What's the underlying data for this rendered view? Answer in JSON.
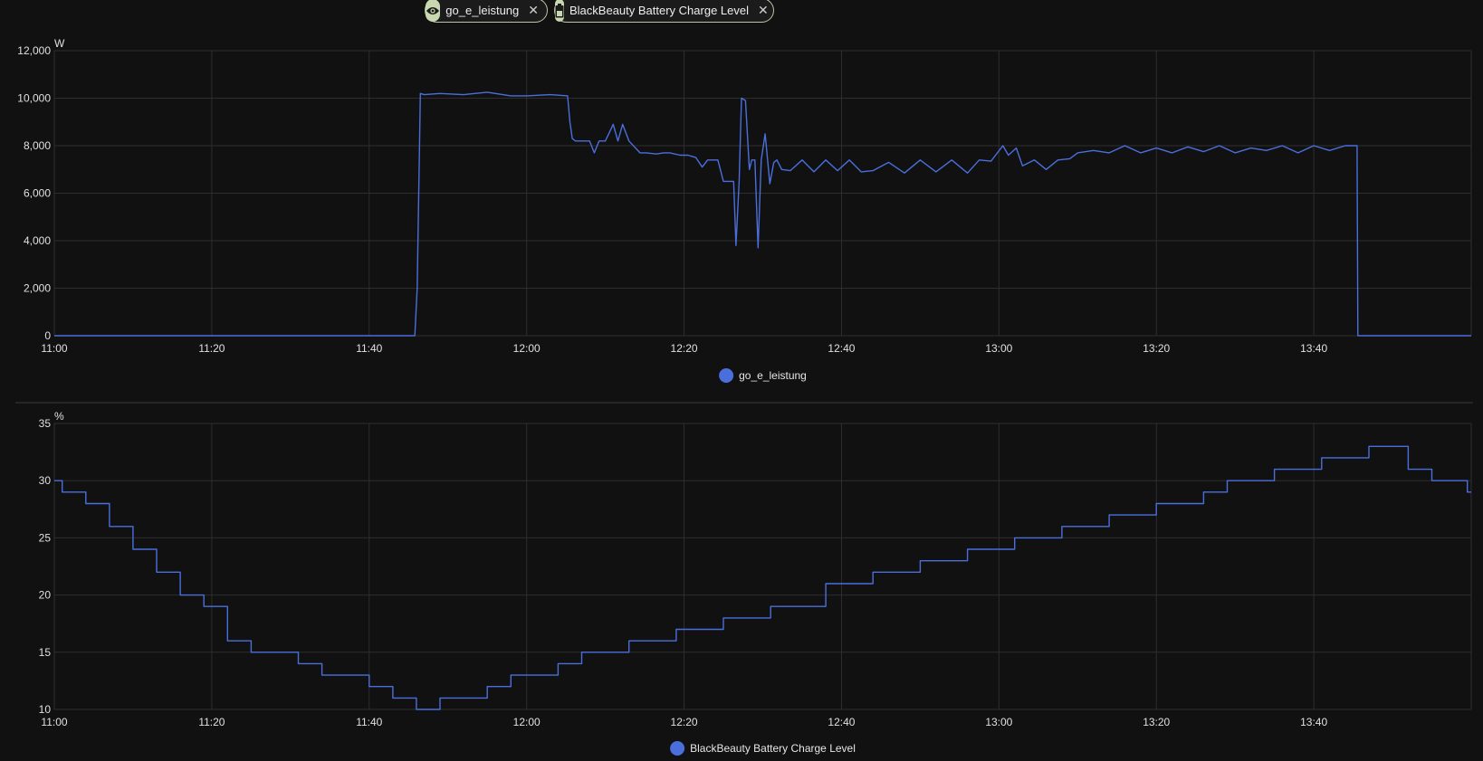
{
  "chips": [
    {
      "label": "go_e_leistung",
      "icon": "eye-icon"
    },
    {
      "label": "BlackBeauty Battery Charge Level",
      "icon": "battery-icon"
    }
  ],
  "colors": {
    "line": "#4a6fdc",
    "grid": "#2e2e2e",
    "background": "#111111",
    "chip_border": "#b9c7a3",
    "chip_icon_bg": "#c9d8b0"
  },
  "chart_data": [
    {
      "type": "line",
      "unit": "W",
      "xlim": [
        "11:00",
        "14:00"
      ],
      "ylim": [
        0,
        12000
      ],
      "x_ticks": [
        "11:00",
        "11:20",
        "11:40",
        "12:00",
        "12:20",
        "12:40",
        "13:00",
        "13:20",
        "13:40"
      ],
      "y_ticks": [
        "0",
        "2,000",
        "4,000",
        "6,000",
        "8,000",
        "10,000",
        "12,000"
      ],
      "y_tick_values": [
        0,
        2000,
        4000,
        6000,
        8000,
        10000,
        12000
      ],
      "grid": true,
      "legend": "bottom-center",
      "series": [
        {
          "name": "go_e_leistung",
          "x": [
            "11:00",
            "11:45.8",
            "11:46.0",
            "11:46.1",
            "11:46.5",
            "11:47.0",
            "11:49.0",
            "11:52.0",
            "11:55.0",
            "11:58.0",
            "12:00.0",
            "12:03.0",
            "12:05.2",
            "12:05.5",
            "12:05.8",
            "12:06.2",
            "12:08.0",
            "12:08.6",
            "12:09.2",
            "12:10.0",
            "12:11.0",
            "12:11.6",
            "12:12.2",
            "12:13.0",
            "12:14.4",
            "12:15.2",
            "12:16.5",
            "12:17.4",
            "12:18.2",
            "12:19.5",
            "12:20.5",
            "12:21.5",
            "12:22.3",
            "12:23.0",
            "12:24.3",
            "12:25.0",
            "12:26.3",
            "12:26.6",
            "12:27.0",
            "12:27.3",
            "12:27.8",
            "12:28.3",
            "12:28.6",
            "12:29.0",
            "12:29.4",
            "12:29.8",
            "12:30.3",
            "12:30.9",
            "12:31.4",
            "12:31.8",
            "12:32.4",
            "12:33.5",
            "12:35.0",
            "12:36.5",
            "12:38.0",
            "12:39.5",
            "12:41.0",
            "12:42.5",
            "12:44.0",
            "12:46.0",
            "12:48.0",
            "12:50.0",
            "12:52.0",
            "12:54.0",
            "12:56.0",
            "12:57.5",
            "12:59.0",
            "13:00.5",
            "13:01.2",
            "13:02.2",
            "13:03.0",
            "13:04.5",
            "13:06.0",
            "13:07.5",
            "13:09.0",
            "13:10.0",
            "13:12.0",
            "13:14.0",
            "13:16.0",
            "13:18.0",
            "13:20.0",
            "13:22.0",
            "13:24.0",
            "13:26.0",
            "13:28.0",
            "13:30.0",
            "13:32.0",
            "13:34.0",
            "13:36.0",
            "13:38.0",
            "13:40.0",
            "13:42.0",
            "13:44.0",
            "13:45.5",
            "13:45.6",
            "13:46.0",
            "14:00"
          ],
          "y": [
            0,
            0,
            1300,
            2000,
            10200,
            10150,
            10200,
            10150,
            10250,
            10100,
            10100,
            10150,
            10100,
            9000,
            8300,
            8200,
            8200,
            7700,
            8200,
            8200,
            8900,
            8200,
            8900,
            8200,
            7700,
            7700,
            7650,
            7700,
            7700,
            7600,
            7600,
            7500,
            7100,
            7400,
            7400,
            6500,
            6500,
            3800,
            6500,
            10000,
            9900,
            7000,
            7400,
            7400,
            3700,
            7400,
            8500,
            6400,
            7300,
            7400,
            7000,
            6950,
            7400,
            6900,
            7400,
            6950,
            7400,
            6900,
            6950,
            7300,
            6850,
            7400,
            6900,
            7400,
            6850,
            7400,
            7350,
            8000,
            7600,
            7900,
            7150,
            7400,
            7000,
            7400,
            7450,
            7700,
            7800,
            7700,
            8000,
            7700,
            7900,
            7700,
            7950,
            7750,
            8000,
            7700,
            7900,
            7800,
            8000,
            7700,
            8000,
            7800,
            8000,
            8000,
            0,
            0,
            0
          ]
        }
      ]
    },
    {
      "type": "line",
      "unit": "%",
      "xlim": [
        "11:00",
        "14:00"
      ],
      "ylim": [
        10,
        35
      ],
      "x_ticks": [
        "11:00",
        "11:20",
        "11:40",
        "12:00",
        "12:20",
        "12:40",
        "13:00",
        "13:20",
        "13:40"
      ],
      "y_ticks": [
        "10",
        "15",
        "20",
        "25",
        "30",
        "35"
      ],
      "y_tick_values": [
        10,
        15,
        20,
        25,
        30,
        35
      ],
      "grid": true,
      "legend": "bottom-center",
      "series": [
        {
          "name": "BlackBeauty Battery Charge Level",
          "step": true,
          "x": [
            "11:00",
            "11:01",
            "11:04",
            "11:07",
            "11:10",
            "11:13",
            "11:16",
            "11:19",
            "11:22",
            "11:25",
            "11:31",
            "11:34",
            "11:40",
            "11:43",
            "11:46",
            "11:49",
            "11:55",
            "11:58",
            "12:04",
            "12:07",
            "12:13",
            "12:19",
            "12:25",
            "12:31",
            "12:38",
            "12:44",
            "12:50",
            "12:56",
            "13:02",
            "13:08",
            "13:14",
            "13:20",
            "13:26",
            "13:29",
            "13:35",
            "13:41",
            "13:47",
            "13:52",
            "13:55",
            "13:59.5"
          ],
          "y": [
            30,
            29,
            28,
            26,
            24,
            22,
            20,
            19,
            16,
            15,
            14,
            13,
            12,
            11,
            10,
            11,
            12,
            13,
            14,
            15,
            16,
            17,
            18,
            19,
            21,
            22,
            23,
            24,
            25,
            26,
            27,
            28,
            29,
            30,
            31,
            32,
            33,
            31,
            30,
            29
          ]
        }
      ]
    }
  ]
}
